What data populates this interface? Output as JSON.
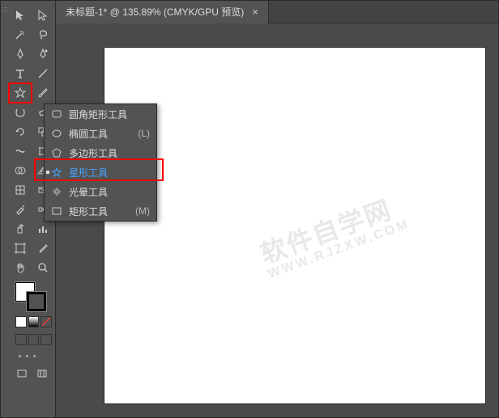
{
  "tab": {
    "title": "未标题-1* @ 135.89% (CMYK/GPU 预览)",
    "close": "×"
  },
  "flyout": {
    "items": [
      {
        "label": "圆角矩形工具",
        "shortcut": ""
      },
      {
        "label": "椭圆工具",
        "shortcut": "(L)"
      },
      {
        "label": "多边形工具",
        "shortcut": ""
      },
      {
        "label": "星形工具",
        "shortcut": ""
      },
      {
        "label": "光晕工具",
        "shortcut": ""
      },
      {
        "label": "矩形工具",
        "shortcut": "(M)"
      }
    ],
    "selected_index": 3
  },
  "watermark": {
    "main": "软件自学网",
    "sub": "WWW.RJZXW.COM"
  },
  "colors": {
    "bg": "#535353",
    "canvas": "#ffffff",
    "highlight": "#ff0000",
    "selected_text": "#4aa3ff"
  }
}
